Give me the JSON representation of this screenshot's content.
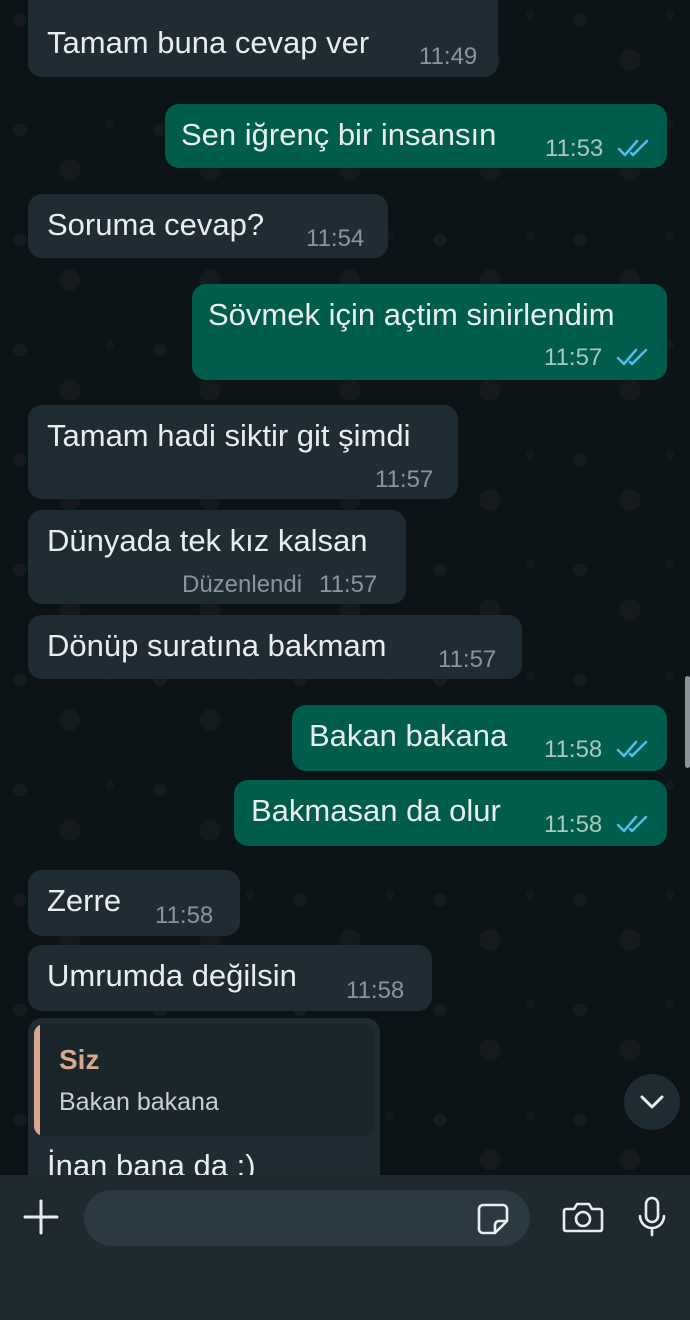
{
  "messages": [
    {
      "text": "Tamam buna cevap ver",
      "time": "11:49"
    },
    {
      "text": "Sen iğrenç bir insansın",
      "time": "11:53"
    },
    {
      "text": "Soruma cevap?",
      "time": "11:54"
    },
    {
      "text": "Sövmek için açtim sinirlendim",
      "time": "11:57"
    },
    {
      "text": "Tamam hadi siktir git şimdi",
      "time": "11:57"
    },
    {
      "text": "Dünyada tek kız kalsan",
      "edited": "Düzenlendi",
      "time": "11:57"
    },
    {
      "text": "Dönüp suratına bakmam",
      "time": "11:57"
    },
    {
      "text": "Bakan bakana",
      "time": "11:58"
    },
    {
      "text": "Bakmasan da olur",
      "time": "11:58"
    },
    {
      "text": "Zerre",
      "time": "11:58"
    },
    {
      "text": "Umrumda değilsin",
      "time": "11:58"
    },
    {
      "text": "İnan bana da :)"
    }
  ],
  "quote": {
    "author": "Siz",
    "text": "Bakan bakana"
  },
  "icons": {
    "read_ticks": "double-check-icon",
    "scroll_down": "chevron-down-icon",
    "attach": "plus-icon",
    "sticker": "sticker-icon",
    "camera": "camera-icon",
    "mic": "microphone-icon"
  },
  "colors": {
    "incoming_bubble": "#202c33",
    "outgoing_bubble": "#005c4b",
    "read_ticks": "#53bdeb",
    "quote_accent": "#d9a88a"
  }
}
